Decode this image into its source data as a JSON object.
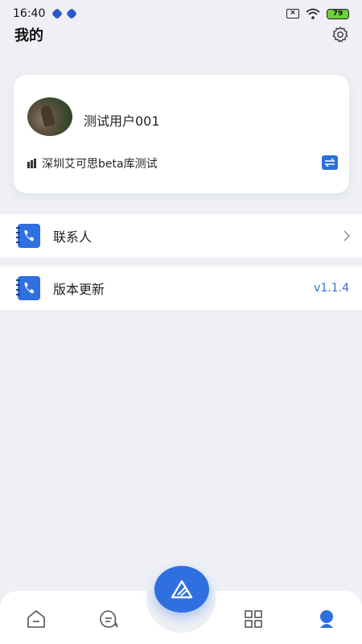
{
  "status": {
    "time": "16:40",
    "battery": "79"
  },
  "header": {
    "title": "我的"
  },
  "profile": {
    "username": "测试用户001",
    "organization": "深圳艾可思beta库测试"
  },
  "menu": {
    "contacts_label": "联系人",
    "update_label": "版本更新",
    "version": "v1.1.4"
  },
  "nav": {
    "tabs": [
      "home",
      "messages",
      "center-action",
      "apps",
      "profile"
    ],
    "active": "profile"
  },
  "colors": {
    "accent": "#2f6fe0",
    "version_text": "#3a6fc4",
    "background": "#eef0f5"
  }
}
